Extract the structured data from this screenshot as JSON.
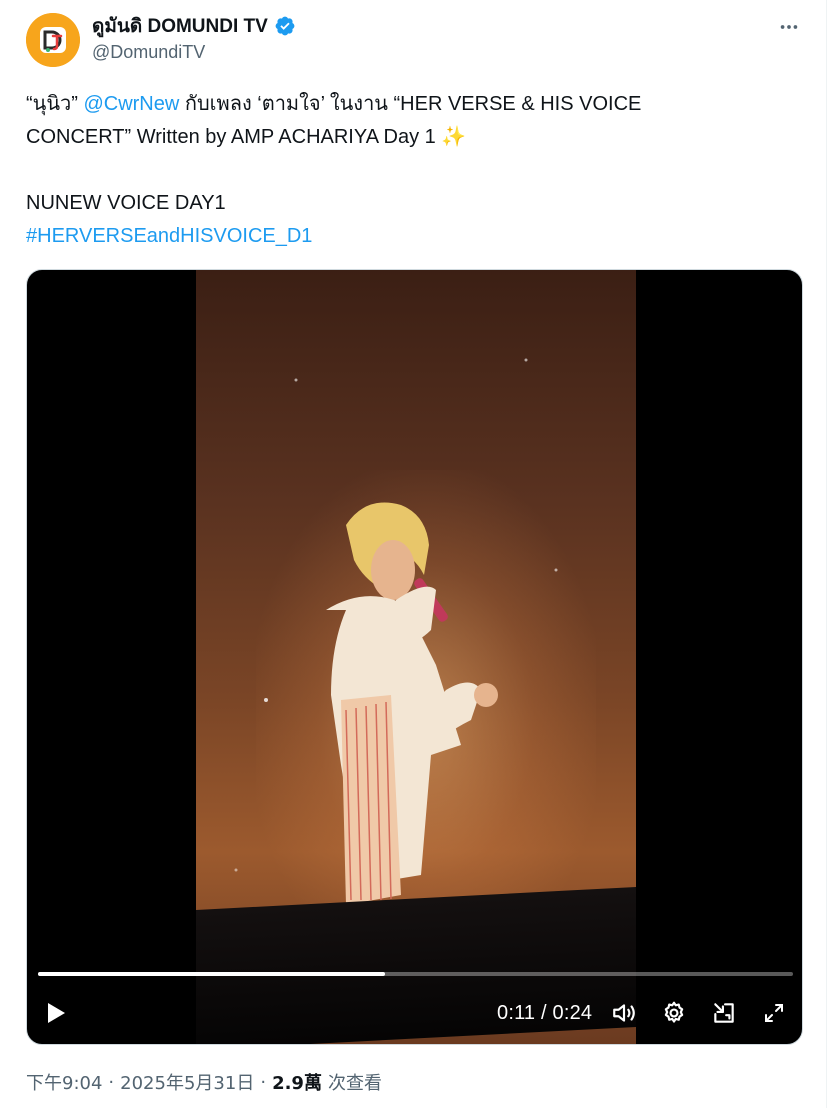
{
  "post": {
    "author_name": "ดูมันดิ DOMUNDI TV",
    "handle": "@DomundiTV",
    "avatar_icon": "domundi-logo-icon",
    "verified_icon": "verified-badge-icon",
    "more_icon": "more-horizontal-icon",
    "text": {
      "line1_prefix": "“นุนิว” ",
      "mention": "@CwrNew",
      "line1_suffix": " กับเพลง ‘ตามใจ’ ในงาน “HER VERSE & HIS VOICE",
      "line2": "CONCERT” Written by AMP ACHARIYA Day 1 ",
      "sparkles": "✨",
      "line4": "NUNEW VOICE DAY1",
      "hashtag": "#HERVERSEandHISVOICE_D1"
    }
  },
  "video": {
    "progress": 0.46,
    "current_time": "0:11",
    "duration": "0:24",
    "time_separator": " / ",
    "controls": {
      "play_icon": "play-icon",
      "volume_icon": "volume-icon",
      "settings_icon": "gear-icon",
      "pip_icon": "picture-in-picture-icon",
      "fullscreen_icon": "fullscreen-icon"
    }
  },
  "footer": {
    "time": "下午9:04",
    "dot1": "·",
    "date": "2025年5月31日",
    "dot2": "·",
    "views_count": "2.9萬",
    "views_label": "次查看"
  },
  "colors": {
    "link": "#1d9bf0",
    "verified": "#1d9bf0",
    "avatar_bg": "#f7a51c",
    "secondary_text": "#536471"
  }
}
